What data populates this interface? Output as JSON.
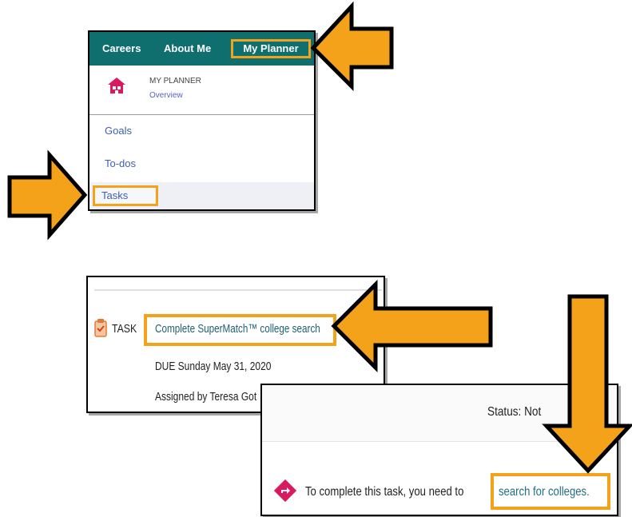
{
  "menu": {
    "nav_tabs": [
      "Careers",
      "About Me",
      "My Planner"
    ],
    "section_title": "MY PLANNER",
    "section_subtitle": "Overview",
    "items": [
      "Goals",
      "To-dos",
      "Tasks"
    ]
  },
  "task": {
    "label": "TASK",
    "link_text": "Complete SuperMatch™ college search",
    "due": "DUE   Sunday May 31, 2020",
    "assigned_by": "Assigned by Teresa Got"
  },
  "status": {
    "status_text": "Status: Not",
    "instruction": "To complete this task, you need to",
    "link_text": "search for colleges."
  },
  "colors": {
    "nav_teal": "#0e6f6e",
    "highlight_orange": "#f5a21b",
    "home_icon_pink": "#d81b60",
    "link_blue": "#3d5fb0"
  },
  "icons": [
    "home-icon",
    "task-icon",
    "diamond-arrow-icon",
    "callout-arrow-icon"
  ]
}
